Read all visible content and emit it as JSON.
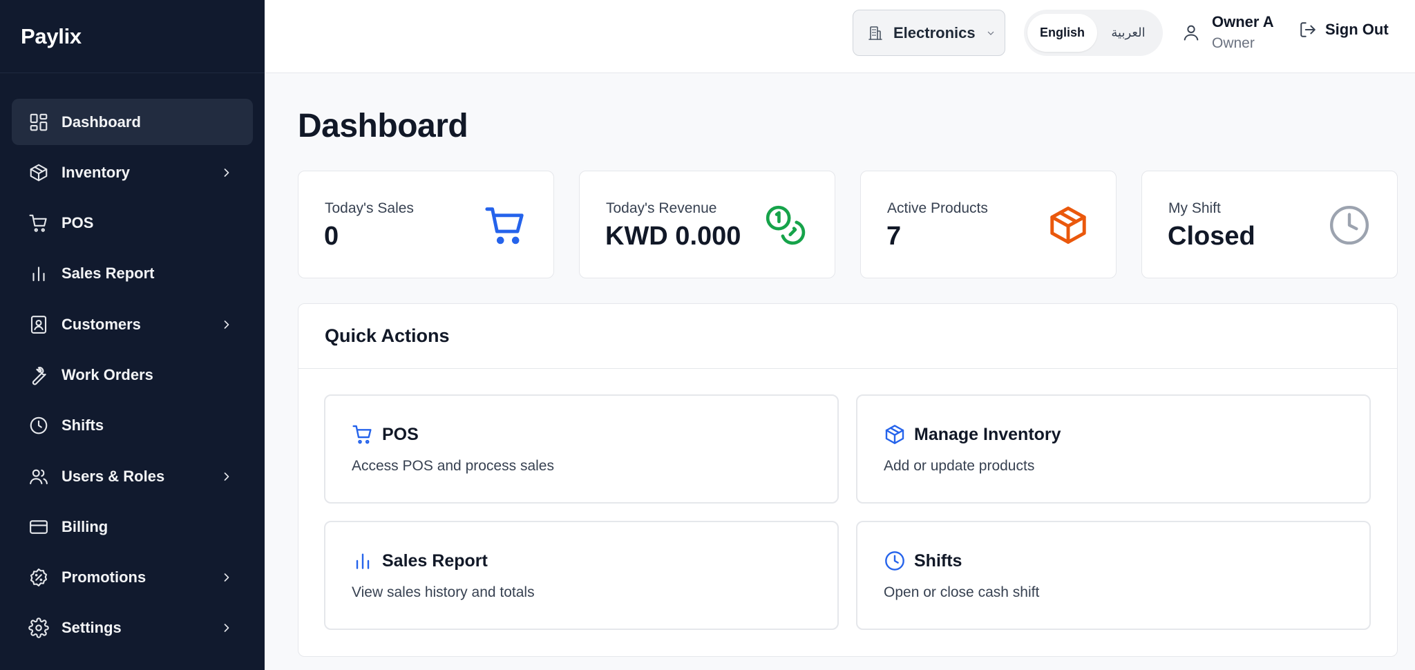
{
  "app": {
    "name": "Paylix"
  },
  "sidebar": {
    "items": [
      {
        "label": "Dashboard",
        "icon": "dashboard-icon",
        "active": true,
        "has_children": false
      },
      {
        "label": "Inventory",
        "icon": "box-icon",
        "active": false,
        "has_children": true
      },
      {
        "label": "POS",
        "icon": "cart-icon",
        "active": false,
        "has_children": false
      },
      {
        "label": "Sales Report",
        "icon": "bar-chart-icon",
        "active": false,
        "has_children": false
      },
      {
        "label": "Customers",
        "icon": "contact-book-icon",
        "active": false,
        "has_children": true
      },
      {
        "label": "Work Orders",
        "icon": "wrench-icon",
        "active": false,
        "has_children": false
      },
      {
        "label": "Shifts",
        "icon": "clock-icon",
        "active": false,
        "has_children": false
      },
      {
        "label": "Users & Roles",
        "icon": "users-icon",
        "active": false,
        "has_children": true
      },
      {
        "label": "Billing",
        "icon": "credit-card-icon",
        "active": false,
        "has_children": false
      },
      {
        "label": "Promotions",
        "icon": "discount-badge-icon",
        "active": false,
        "has_children": true
      },
      {
        "label": "Settings",
        "icon": "gear-icon",
        "active": false,
        "has_children": true
      }
    ]
  },
  "header": {
    "store_select": {
      "value": "Electronics"
    },
    "language": {
      "english": "English",
      "arabic": "العربية",
      "selected": "English"
    },
    "user": {
      "name": "Owner A",
      "role": "Owner"
    },
    "sign_out": "Sign Out"
  },
  "main": {
    "title": "Dashboard",
    "stats": [
      {
        "label": "Today's Sales",
        "value": "0",
        "icon": "cart-icon",
        "color": "#2563eb"
      },
      {
        "label": "Today's Revenue",
        "value": "KWD 0.000",
        "icon": "coins-icon",
        "color": "#16a34a"
      },
      {
        "label": "Active Products",
        "value": "7",
        "icon": "box-icon",
        "color": "#ea580c"
      },
      {
        "label": "My Shift",
        "value": "Closed",
        "icon": "clock-icon",
        "color": "#9ca3af"
      }
    ],
    "quick_actions": {
      "title": "Quick Actions",
      "items": [
        {
          "title": "POS",
          "description": "Access POS and process sales",
          "icon": "cart-icon"
        },
        {
          "title": "Manage Inventory",
          "description": "Add or update products",
          "icon": "box-icon"
        },
        {
          "title": "Sales Report",
          "description": "View sales history and totals",
          "icon": "bar-chart-icon"
        },
        {
          "title": "Shifts",
          "description": "Open or close cash shift",
          "icon": "clock-icon"
        }
      ]
    }
  },
  "colors": {
    "sidebar_bg": "#111a2e",
    "accent": "#2563eb"
  }
}
